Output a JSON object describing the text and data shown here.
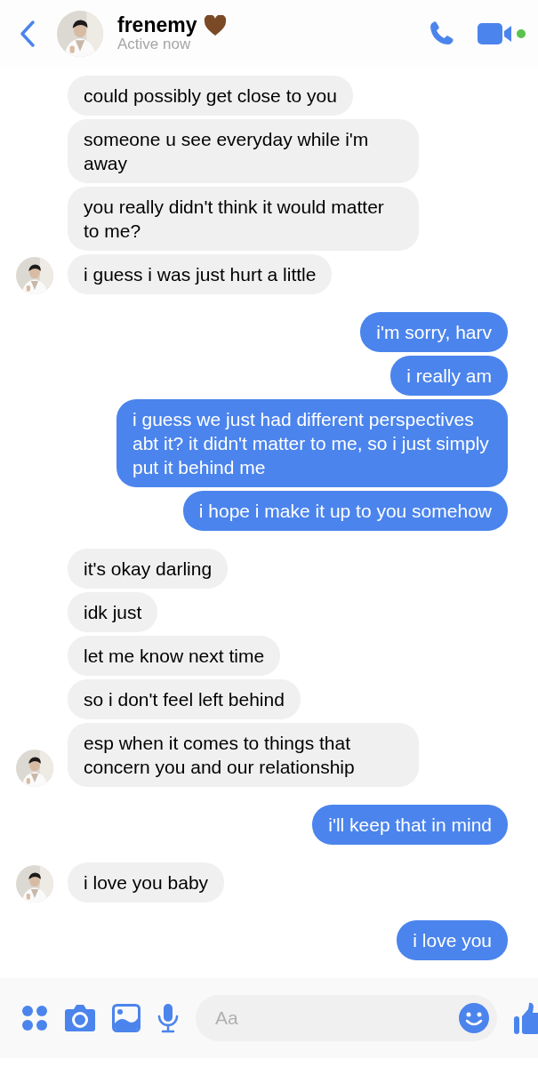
{
  "contact": {
    "name": "frenemy",
    "status": "Active now",
    "online": true
  },
  "messages": [
    {
      "kind": "received",
      "text": "could possibly get close to you",
      "avatar": false
    },
    {
      "kind": "received",
      "text": "someone u see everyday while i'm away",
      "avatar": false
    },
    {
      "kind": "received",
      "text": "you really didn't think it would matter to me?",
      "avatar": false
    },
    {
      "kind": "received",
      "text": "i guess i was just hurt a little",
      "avatar": true
    },
    {
      "kind": "sent",
      "text": "i'm sorry, harv"
    },
    {
      "kind": "sent",
      "text": "i really am"
    },
    {
      "kind": "sent",
      "text": "i guess we just had different perspectives abt it? it didn't matter to me, so i just simply put it behind me"
    },
    {
      "kind": "sent",
      "text": "i hope i make it up to you somehow"
    },
    {
      "kind": "received",
      "text": "it's okay darling",
      "avatar": false
    },
    {
      "kind": "received",
      "text": "idk just",
      "avatar": false
    },
    {
      "kind": "received",
      "text": "let me know next time",
      "avatar": false
    },
    {
      "kind": "received",
      "text": "so i don't feel left behind",
      "avatar": false
    },
    {
      "kind": "received",
      "text": "esp when it comes to things that concern you and our relationship",
      "avatar": true
    },
    {
      "kind": "sent",
      "text": "i'll keep that in mind"
    },
    {
      "kind": "received",
      "text": "i love you baby",
      "avatar": true
    },
    {
      "kind": "sent",
      "text": "i love you"
    }
  ],
  "composer": {
    "placeholder": "Aa"
  }
}
